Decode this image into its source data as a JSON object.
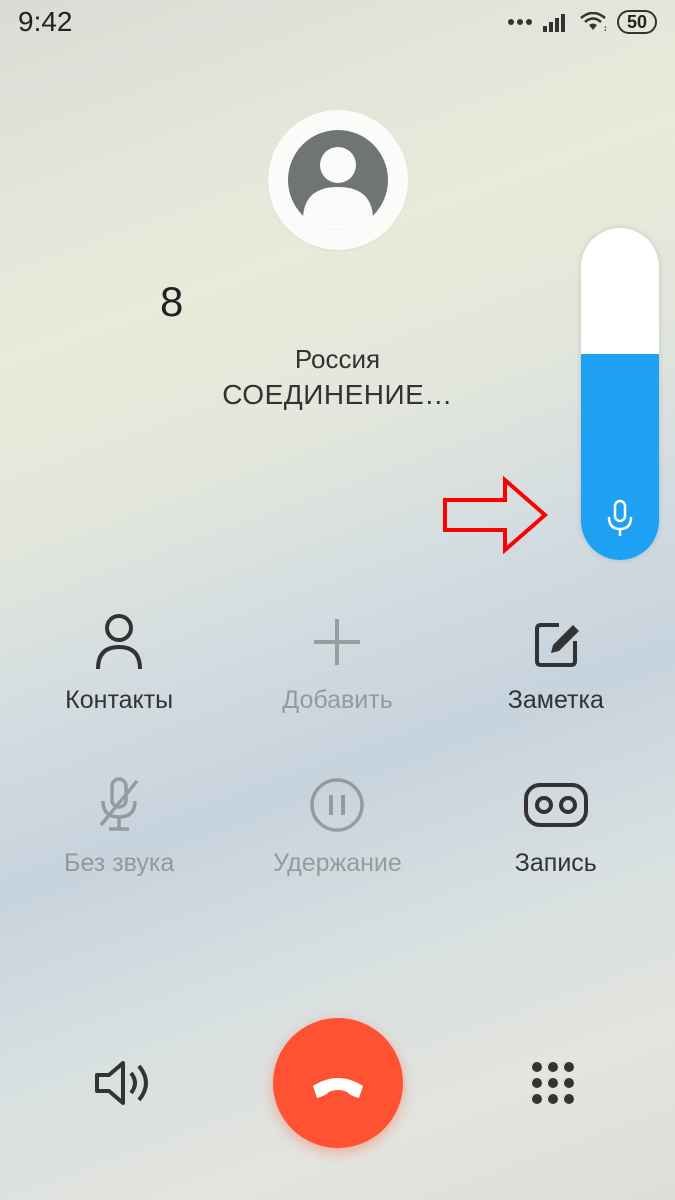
{
  "status": {
    "time": "9:42",
    "battery": "50"
  },
  "call": {
    "number": "8",
    "region": "Россия",
    "status": "СОЕДИНЕНИЕ…"
  },
  "volume": {
    "level_percent": 62
  },
  "buttons": {
    "contacts": "Контакты",
    "add": "Добавить",
    "note": "Заметка",
    "mute": "Без звука",
    "hold": "Удержание",
    "record": "Запись"
  },
  "colors": {
    "accent": "#1ea0f3",
    "end_call": "#ff5232",
    "annotation": "#ff0000"
  }
}
